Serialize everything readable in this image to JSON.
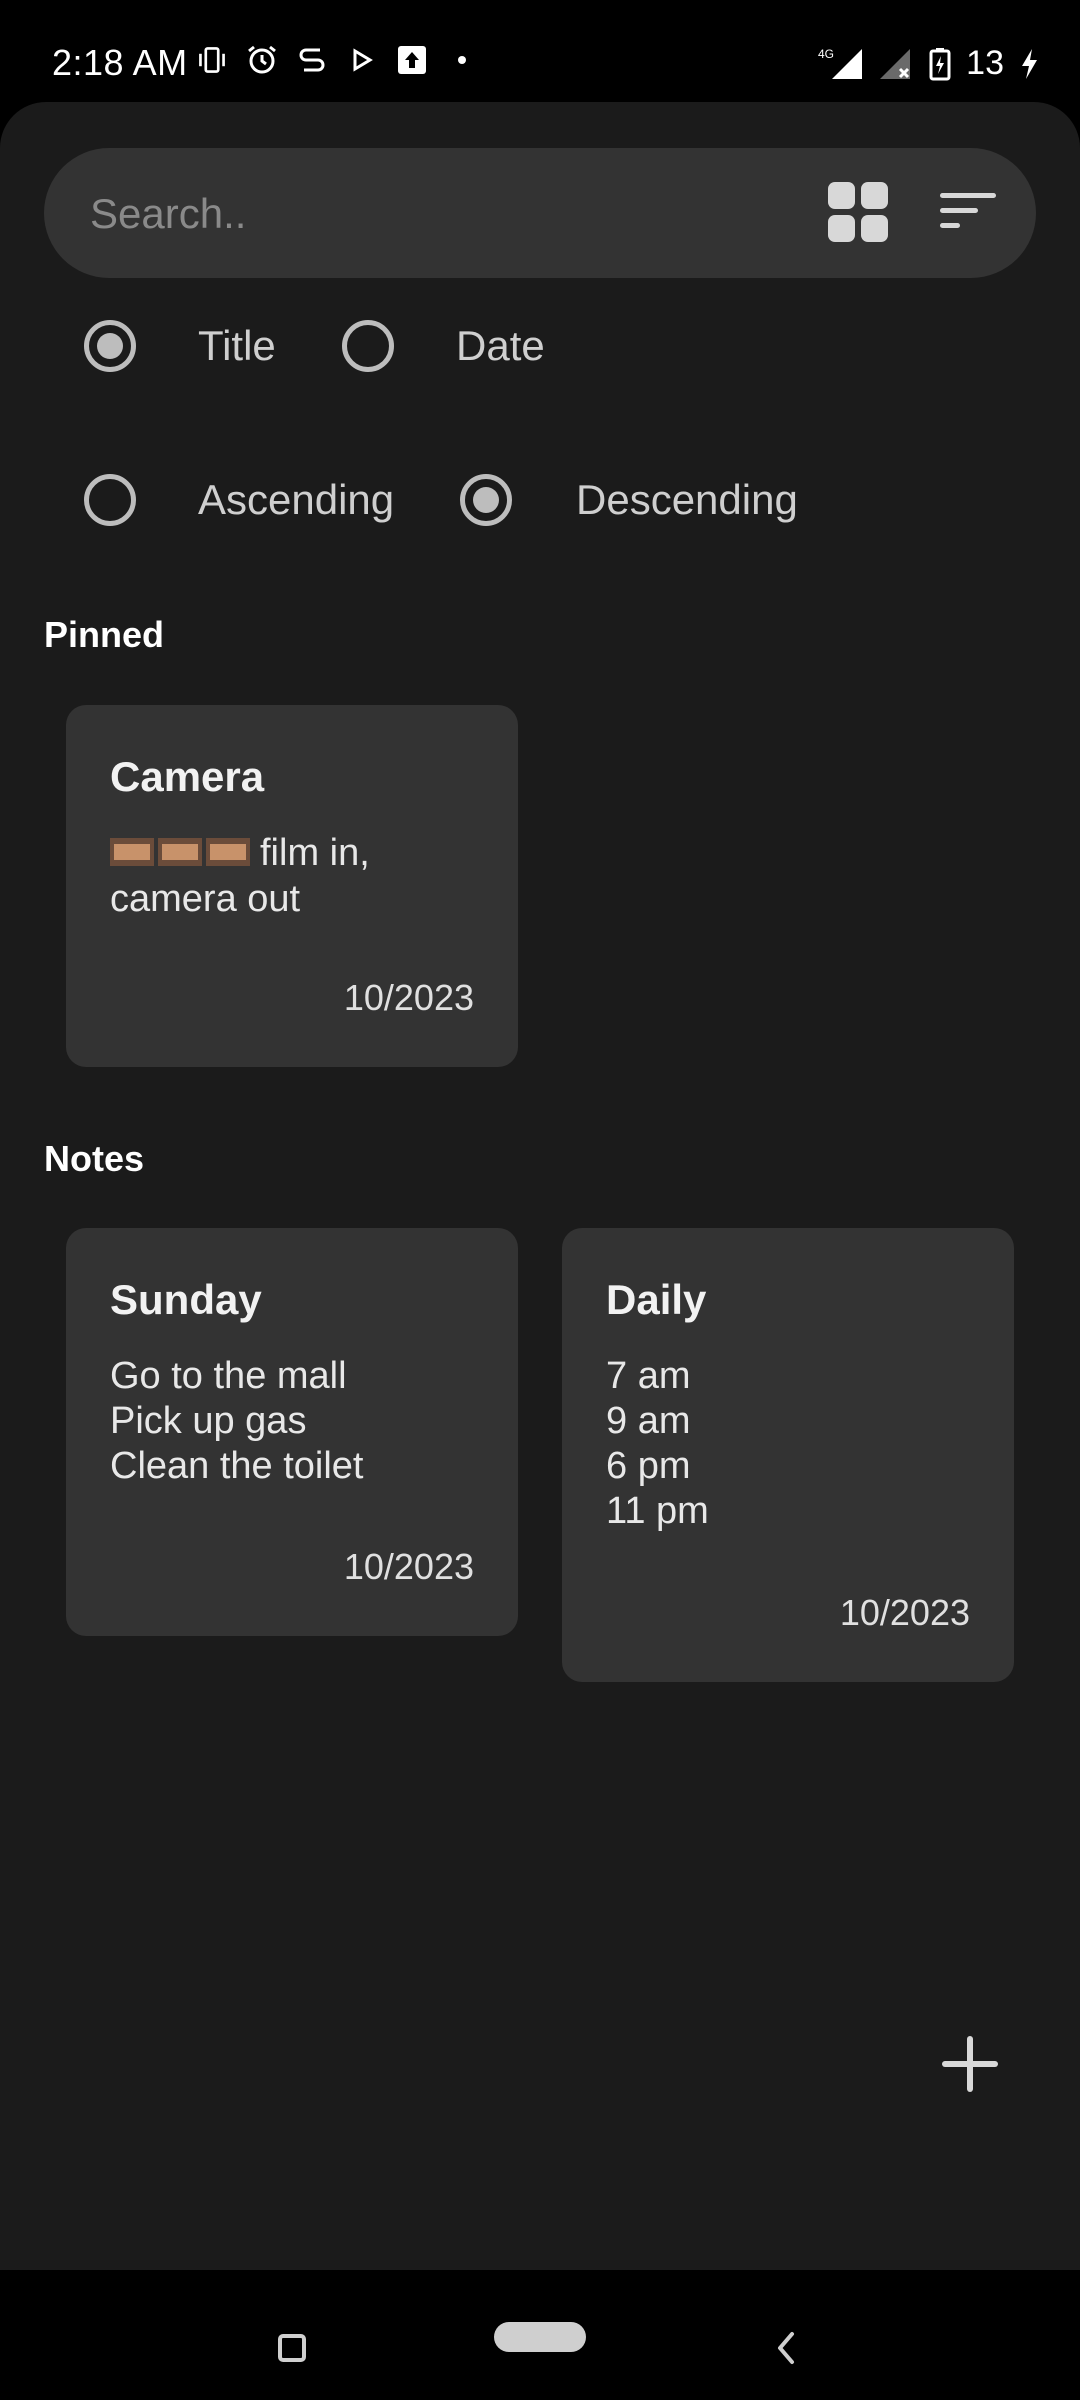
{
  "status_bar": {
    "time": "2:18 AM",
    "network": "4G",
    "battery": "13",
    "icons_left": [
      "vibrate-icon",
      "alarm-icon",
      "sync-icon",
      "play-store-icon",
      "upload-icon",
      "dot-icon"
    ],
    "icons_right": [
      "signal-4g-icon",
      "signal-no-service-icon",
      "battery-charging-icon",
      "charging-bolt-icon"
    ]
  },
  "search": {
    "placeholder": "Search.."
  },
  "sort": {
    "by": [
      {
        "label": "Title",
        "checked": true
      },
      {
        "label": "Date",
        "checked": false
      }
    ],
    "order": [
      {
        "label": "Ascending",
        "checked": false
      },
      {
        "label": "Descending",
        "checked": true
      }
    ]
  },
  "sections": {
    "pinned_title": "Pinned",
    "notes_title": "Notes"
  },
  "pinned_notes": [
    {
      "title": "Camera",
      "body_lines": [
        "film in,",
        "camera out"
      ],
      "date": "10/2023"
    }
  ],
  "notes": [
    {
      "title": "Sunday",
      "body_lines": [
        "Go to the mall",
        "Pick up gas",
        "Clean the toilet"
      ],
      "date": "10/2023"
    },
    {
      "title": "Daily",
      "body_lines": [
        "7 am",
        "9 am",
        "6 pm",
        "11 pm"
      ],
      "date": "10/2023"
    }
  ],
  "colors": {
    "background": "#1b1b1b",
    "card": "#333333",
    "search_bar": "#333333",
    "accent_gray": "#bdbdbd"
  }
}
